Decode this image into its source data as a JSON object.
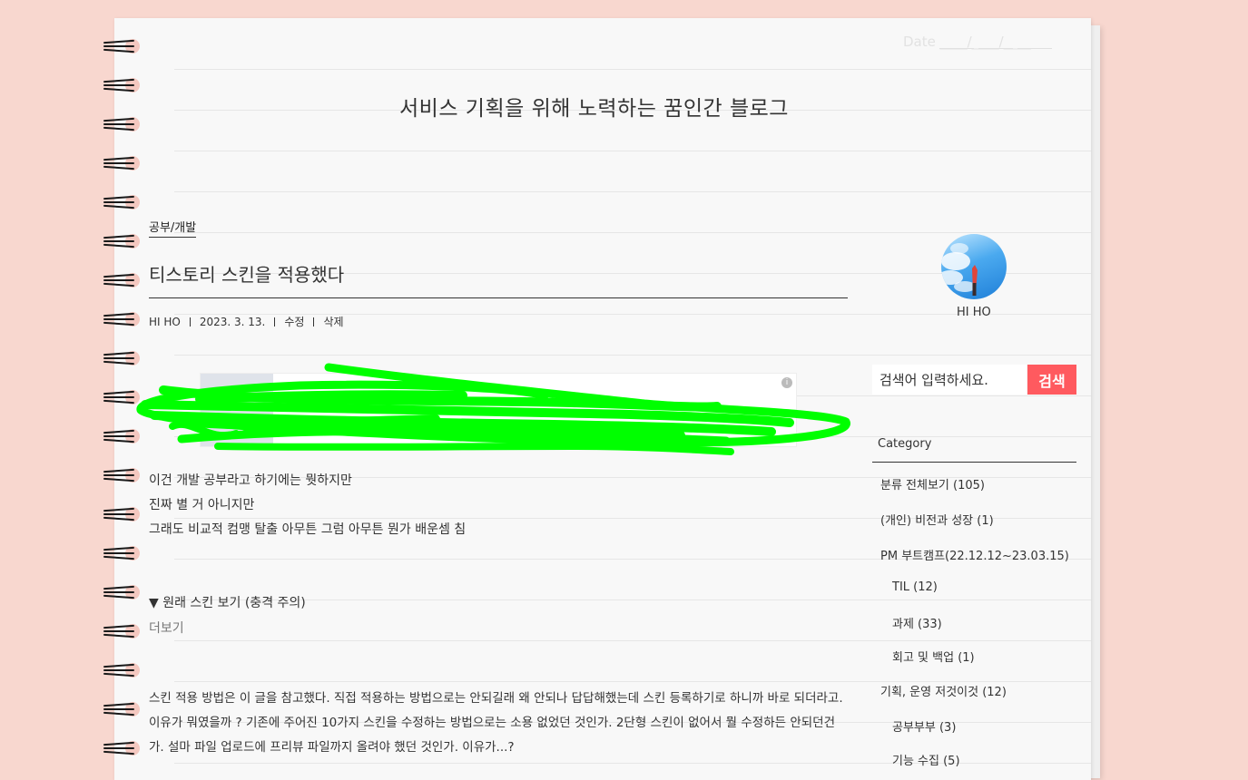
{
  "header": {
    "date_label": "Date ____/____/____",
    "blog_title": "서비스 기획을 위해 노력하는 꿈인간 블로그"
  },
  "post": {
    "category": "공부/개발",
    "title": "티스토리 스킨을 적용했다",
    "meta": {
      "author": "HI HO",
      "date": "2023. 3. 13.",
      "edit": "수정",
      "delete": "삭제"
    },
    "ad": {
      "info_icon": "info-icon",
      "redaction": "green-scribble"
    },
    "intro_lines": [
      "이건 개발 공부라고 하기에는 뭣하지만",
      "진짜 별 거 아니지만",
      "그래도 비교적 컴맹 탈출 아무튼 그럼 아무튼 뭔가 배운셈 침"
    ],
    "more_toggle": "▼ 원래 스킨 보기 (충격 주의)",
    "more_label": "더보기",
    "paragraph": "스킨 적용 방법은 이 글을 참고했다. 직접 적용하는 방법으로는 안되길래 왜 안되나 답답해했는데 스킨 등록하기로 하니까 바로 되더라고. 이유가 뭐였을까 ? 기존에 주어진 10가지 스킨을 수정하는 방법으로는 소용 없었던 것인가. 2단형 스킨이 없어서 뭘 수정하든 안되던건가. 설마 파일 업로드에 프리뷰 파일까지 올려야 했던 것인가. 이유가...?"
  },
  "sidebar": {
    "nickname": "HI HO",
    "search": {
      "placeholder": "검색어 입력하세요.",
      "button": "검색"
    },
    "category_heading": "Category",
    "categories": [
      {
        "label": "분류 전체보기 (105)",
        "level": 0
      },
      {
        "label": "(개인) 비전과 성장 (1)",
        "level": 0
      },
      {
        "label": "PM 부트캠프(22.12.12~23.03.15)",
        "level": 0
      },
      {
        "label": "TIL (12)",
        "level": 1
      },
      {
        "label": "과제 (33)",
        "level": 1
      },
      {
        "label": "회고 및 백업 (1)",
        "level": 1
      },
      {
        "label": "기획, 운영 저것이것 (12)",
        "level": 0
      },
      {
        "label": "공부부부 (3)",
        "level": 1
      },
      {
        "label": "기능 수집 (5)",
        "level": 1
      }
    ]
  },
  "colors": {
    "background": "#f8d7cf",
    "paper": "#f8f8f8",
    "accent": "#ff5a5f",
    "redaction": "#00ff00"
  }
}
